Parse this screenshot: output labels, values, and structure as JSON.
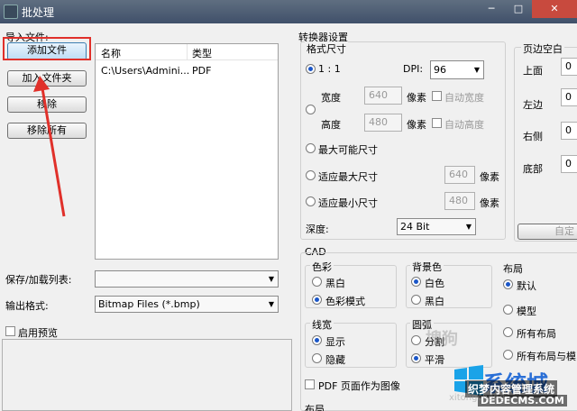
{
  "window": {
    "title": "批处理",
    "controls": [
      "─",
      "□",
      "✕"
    ]
  },
  "left": {
    "import_label": "导入文件:",
    "add_file": "添加文件",
    "add_folder": "加入文件夹",
    "remove": "移除",
    "remove_all": "移除所有",
    "list": {
      "columns": [
        "名称",
        "类型"
      ],
      "rows": [
        {
          "name": "C:\\Users\\Admini...",
          "type": "PDF"
        }
      ]
    },
    "save_load_label": "保存/加载列表:",
    "save_load_value": "",
    "output_format_label": "输出格式:",
    "output_format_value": "Bitmap Files (*.bmp)",
    "enable_preview": "启用预览"
  },
  "converter": {
    "title": "转换器设置",
    "format_size": "格式尺寸",
    "ratio": "1 : 1",
    "dpi_label": "DPI:",
    "dpi_value": "96",
    "width_label": "宽度",
    "width_value": "640",
    "height_label": "高度",
    "height_value": "480",
    "pixels": "像素",
    "auto_width": "自动宽度",
    "auto_height": "自动高度",
    "max_size": "最大可能尺寸",
    "fit_max": "适应最大尺寸",
    "fit_max_value": "640",
    "fit_min": "适应最小尺寸",
    "fit_min_value": "480",
    "depth_label": "深度:",
    "depth_value": "24 Bit"
  },
  "margins": {
    "title": "页边空白",
    "top": "上面",
    "left": "左边",
    "right": "右侧",
    "bottom": "底部",
    "top_value": "0",
    "left_value": "0",
    "right_value": "0",
    "bottom_value": "0",
    "custom": "自定"
  },
  "cad": {
    "title": "CAD",
    "color": "色彩",
    "bw": "黑白",
    "color_mode": "色彩模式",
    "bg": "背景色",
    "white": "白色",
    "black": "黑白",
    "layout": "布局",
    "default": "默认",
    "model": "模型",
    "all_layouts": "所有布局",
    "all_layouts_model": "所有布局与模",
    "lineweight": "线宽",
    "show": "显示",
    "hide": "隐藏",
    "arc": "圆弧",
    "split": "分割",
    "smooth": "平滑",
    "pdf_as_image": "PDF 页面作为图像",
    "layout2": "布局"
  },
  "watermark": {
    "sogou": "搜狗",
    "xitong": "系统城",
    "site_text": "织梦内容管理系统",
    "site_url": "DEDECMS.COM",
    "pinyin": "xitongcheng"
  },
  "colors": {
    "annotation": "#e0302a",
    "titlebar": "#4a5a70"
  }
}
